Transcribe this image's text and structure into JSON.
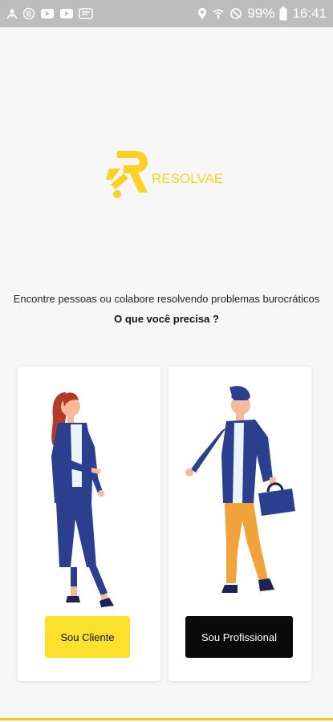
{
  "status_bar": {
    "battery": "99%",
    "time": "16:41",
    "icons_left": [
      "person-icon",
      "b-badge-icon",
      "youtube-icon",
      "youtube-icon",
      "message-icon"
    ],
    "icons_right": [
      "location-icon",
      "wifi-icon",
      "do-not-disturb-icon",
      "battery-icon"
    ]
  },
  "brand": {
    "name": "RESOLVAE",
    "color": "#FBD127"
  },
  "intro": {
    "tagline": "Encontre pessoas ou colabore resolvendo problemas burocráticos",
    "question": "O que você precisa ?"
  },
  "options": {
    "client": {
      "label": "Sou Cliente",
      "button_color": "#FBE12E",
      "illustration": "woman-figure"
    },
    "professional": {
      "label": "Sou Profissional",
      "button_color": "#0A0A0A",
      "illustration": "man-with-briefcase-figure"
    }
  }
}
